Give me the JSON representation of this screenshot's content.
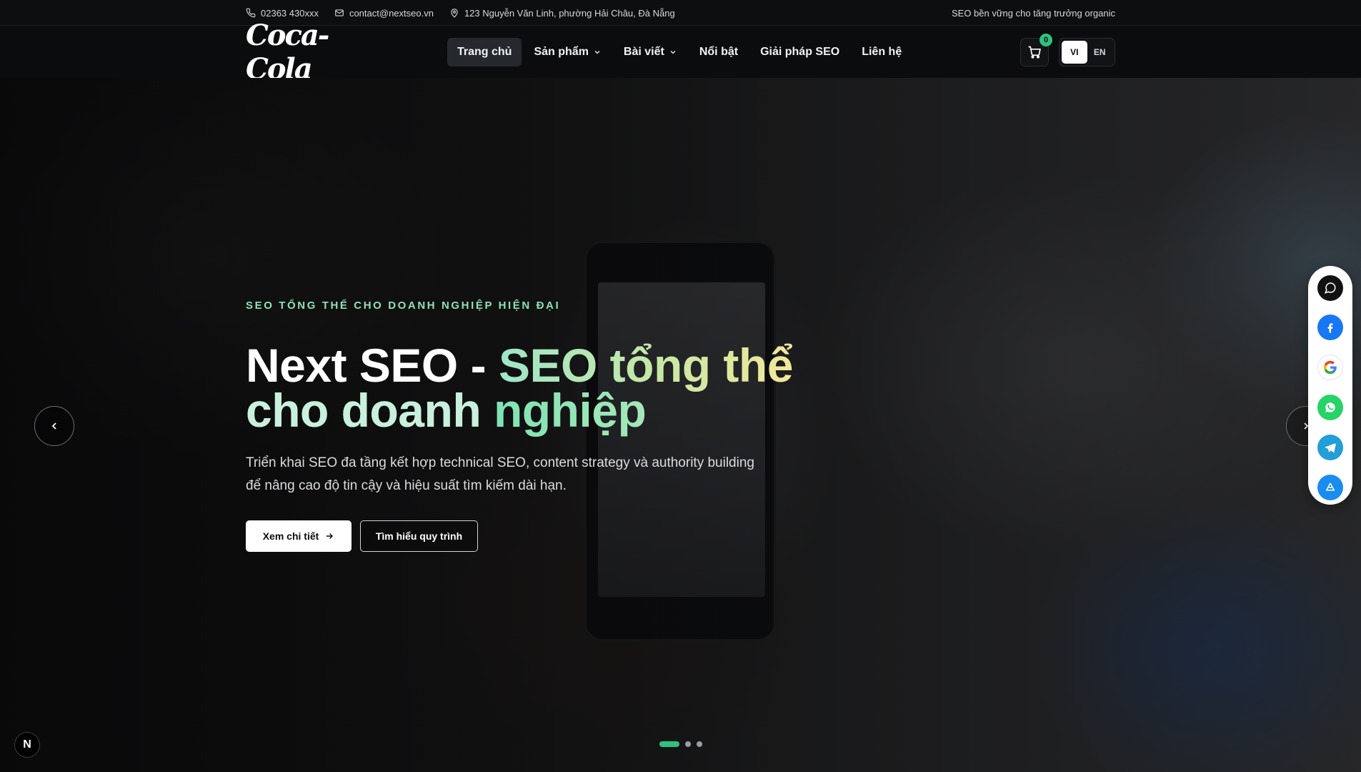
{
  "topbar": {
    "phone": "02363 430xxx",
    "email": "contact@nextseo.vn",
    "address": "123 Nguyễn Văn Linh, phường Hải Châu, Đà Nẵng",
    "tagline": "SEO bền vững cho tăng trưởng organic"
  },
  "header": {
    "logo_text": "Coca-Cola",
    "nav": [
      {
        "label": "Trang chủ",
        "active": true
      },
      {
        "label": "Sản phẩm",
        "dropdown": true
      },
      {
        "label": "Bài viết",
        "dropdown": true
      },
      {
        "label": "Nổi bật"
      },
      {
        "label": "Giải pháp SEO"
      },
      {
        "label": "Liên hệ"
      }
    ],
    "cart_count": "0",
    "lang": {
      "vi": "VI",
      "en": "EN",
      "selected": "VI"
    }
  },
  "hero": {
    "eyebrow": "SEO TỔNG THỂ CHO DOANH NGHIỆP HIỆN ĐẠI",
    "headline_part1": "Next SEO - ",
    "headline_part2": "SEO tổng thể",
    "headline_part3": "cho doanh ",
    "headline_part4": "nghiệp",
    "lead": "Triển khai SEO đa tầng kết hợp technical SEO, content strategy và authority building để nâng cao độ tin cậy và hiệu suất tìm kiếm dài hạn.",
    "btn_primary": "Xem chi tiết",
    "btn_secondary": "Tìm hiểu quy trình",
    "slides_total": 3,
    "slide_active": 1
  },
  "floating": {
    "n_badge": "N",
    "social_icons": [
      "chat-icon",
      "facebook-icon",
      "google-icon",
      "whatsapp-icon",
      "telegram-icon",
      "appstore-icon"
    ]
  },
  "colors": {
    "accent_green": "#2ec27e",
    "eyebrow": "#8fe0b5"
  }
}
